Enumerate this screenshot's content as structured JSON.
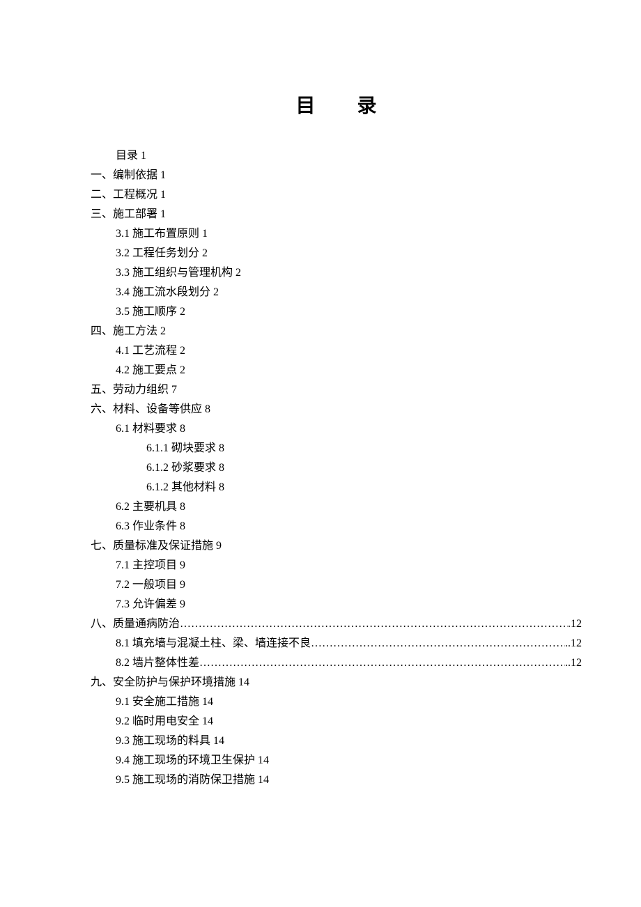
{
  "title": "目录",
  "dots": "……………………………………………………………………………………………………………………………………",
  "entries": [
    {
      "level": "lvl1-first",
      "text": "目录 1",
      "type": "plain"
    },
    {
      "level": "lvl1",
      "text": "一、编制依据 1",
      "type": "plain"
    },
    {
      "level": "lvl1",
      "text": "二、工程概况 1",
      "type": "plain"
    },
    {
      "level": "lvl1",
      "text": "三、施工部署 1",
      "type": "plain"
    },
    {
      "level": "lvl2",
      "text": "3.1  施工布置原则 1",
      "type": "plain"
    },
    {
      "level": "lvl2",
      "text": "3.2  工程任务划分 2",
      "type": "plain"
    },
    {
      "level": "lvl2",
      "text": "3.3  施工组织与管理机构 2",
      "type": "plain"
    },
    {
      "level": "lvl2",
      "text": "3.4  施工流水段划分 2",
      "type": "plain"
    },
    {
      "level": "lvl2",
      "text": "3.5  施工顺序 2",
      "type": "plain"
    },
    {
      "level": "lvl1",
      "text": "四、施工方法 2",
      "type": "plain"
    },
    {
      "level": "lvl2",
      "text": "4.1  工艺流程 2",
      "type": "plain"
    },
    {
      "level": "lvl2",
      "text": "4.2  施工要点 2",
      "type": "plain"
    },
    {
      "level": "lvl1",
      "text": "五、劳动力组织 7",
      "type": "plain"
    },
    {
      "level": "lvl1",
      "text": "六、材料、设备等供应 8",
      "type": "plain"
    },
    {
      "level": "lvl2",
      "text": "6.1  材料要求 8",
      "type": "plain"
    },
    {
      "level": "lvl3",
      "text": "6.1.1 砌块要求 8",
      "type": "plain"
    },
    {
      "level": "lvl3",
      "text": "6.1.2 砂浆要求 8",
      "type": "plain"
    },
    {
      "level": "lvl3",
      "text": "6.1.2 其他材料 8",
      "type": "plain"
    },
    {
      "level": "lvl2",
      "text": "6.2  主要机具 8",
      "type": "plain"
    },
    {
      "level": "lvl2",
      "text": "6.3  作业条件 8",
      "type": "plain"
    },
    {
      "level": "lvl1",
      "text": "七、质量标准及保证措施 9",
      "type": "plain"
    },
    {
      "level": "lvl2",
      "text": "7.1  主控项目 9",
      "type": "plain"
    },
    {
      "level": "lvl2",
      "text": "7.2  一般项目 9",
      "type": "plain"
    },
    {
      "level": "lvl2",
      "text": "7.3  允许偏差 9",
      "type": "plain"
    },
    {
      "level": "lvl1",
      "label": "八、质量通病防治",
      "page": ".12",
      "type": "dotted"
    },
    {
      "level": "lvl2",
      "label": "8.1 填充墙与混凝土柱、梁、墙连接不良",
      "page": "..12",
      "type": "dotted"
    },
    {
      "level": "lvl2",
      "label": "8.2 墙片整体性差",
      "page": "..12",
      "type": "dotted"
    },
    {
      "level": "lvl1",
      "text": "九、安全防护与保护环境措施 14",
      "type": "plain"
    },
    {
      "level": "lvl2",
      "text": "9.1  安全施工措施 14",
      "type": "plain"
    },
    {
      "level": "lvl2",
      "text": "9.2  临时用电安全 14",
      "type": "plain"
    },
    {
      "level": "lvl2",
      "text": "9.3  施工现场的料具 14",
      "type": "plain"
    },
    {
      "level": "lvl2",
      "text": "9.4  施工现场的环境卫生保护 14",
      "type": "plain"
    },
    {
      "level": "lvl2",
      "text": "9.5  施工现场的消防保卫措施 14",
      "type": "plain"
    }
  ]
}
